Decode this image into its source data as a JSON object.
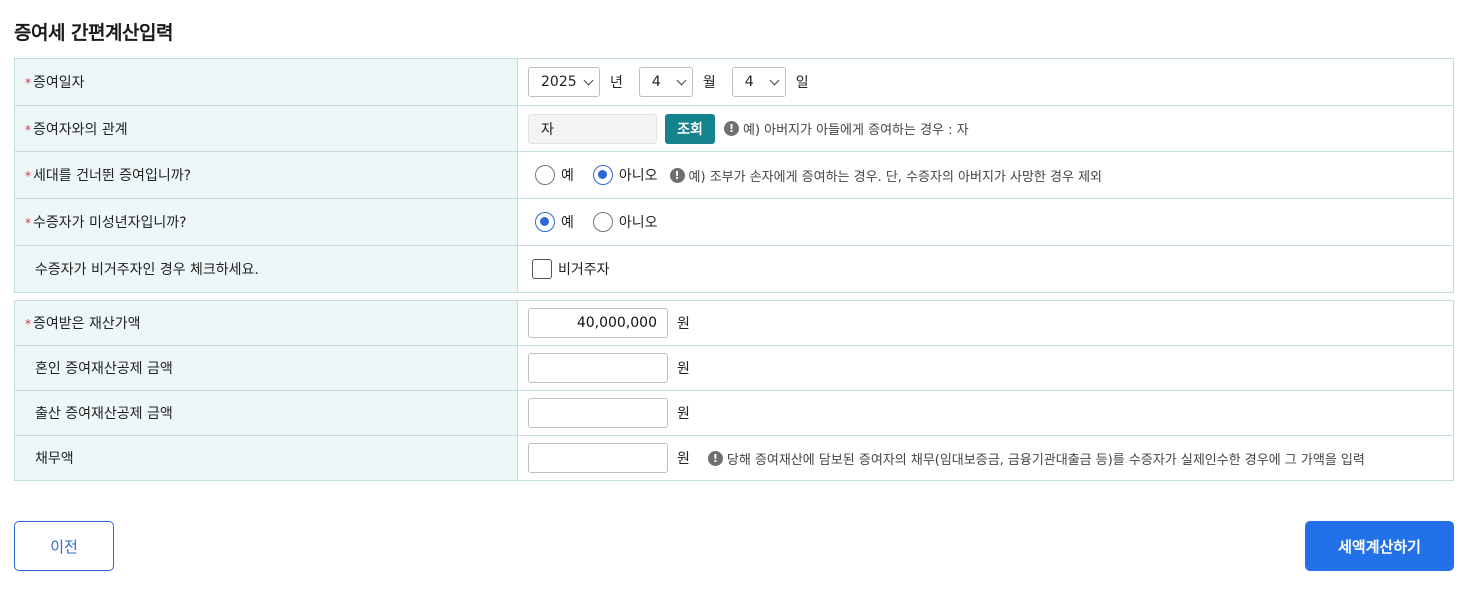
{
  "page_title": "증여세 간편계산입력",
  "required_mark": "*",
  "section1": {
    "gift_date": {
      "label": "증여일자",
      "year": "2025",
      "year_unit": "년",
      "month": "4",
      "month_unit": "월",
      "day": "4",
      "day_unit": "일"
    },
    "relationship": {
      "label": "증여자와의 관계",
      "value": "자",
      "lookup_button": "조회",
      "hint": "예) 아버지가 아들에게 증여하는 경우 : 자"
    },
    "generation_skip": {
      "label": "세대를 건너뛴 증여입니까?",
      "option_yes": "예",
      "option_no": "아니오",
      "selected": "아니오",
      "hint": "예) 조부가 손자에게 증여하는 경우. 단, 수증자의 아버지가 사망한 경우 제외"
    },
    "minor": {
      "label": "수증자가 미성년자입니까?",
      "option_yes": "예",
      "option_no": "아니오",
      "selected": "예"
    },
    "non_resident": {
      "label": "수증자가 비거주자인 경우 체크하세요.",
      "checkbox_label": "비거주자",
      "checked": false
    }
  },
  "section2": {
    "property_value": {
      "label": "증여받은 재산가액",
      "value": "40,000,000",
      "unit": "원"
    },
    "marriage_deduction": {
      "label": "혼인 증여재산공제 금액",
      "value": "",
      "unit": "원"
    },
    "birth_deduction": {
      "label": "출산 증여재산공제 금액",
      "value": "",
      "unit": "원"
    },
    "debt": {
      "label": "채무액",
      "value": "",
      "unit": "원",
      "hint": "당해 증여재산에 담보된 증여자의 채무(임대보증금, 금융기관대출금 등)를 수증자가 실제인수한 경우에 그 가액을 입력"
    }
  },
  "buttons": {
    "prev": "이전",
    "calculate": "세액계산하기"
  },
  "colors": {
    "accent": "#2371e8",
    "lookup": "#14838b",
    "label_bg": "#eef7f7",
    "border": "#c5dcde",
    "required": "#d8344a"
  },
  "icons": {
    "hint": "exclamation-circle-icon",
    "dropdown": "chevron-down-icon"
  }
}
